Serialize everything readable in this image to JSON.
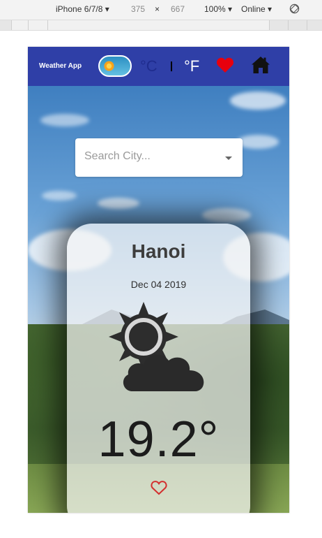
{
  "devtools": {
    "device": "iPhone 6/7/8 ▾",
    "width": "375",
    "times": "×",
    "height": "667",
    "zoom": "100% ▾",
    "network": "Online ▾",
    "rotate_icon": "rotate-icon"
  },
  "appbar": {
    "brand": "Weather App",
    "theme_toggle_icon": "sun-icon",
    "unit_celsius": "°C",
    "unit_fahrenheit": "°F",
    "favorites_icon": "heart-filled-icon",
    "home_icon": "home-icon",
    "colors": {
      "bar": "#2f3fa7",
      "active_unit": "#1f2c8e",
      "inactive_unit": "#ffffff",
      "heart": "#e8000d"
    }
  },
  "search": {
    "placeholder": "Search City...",
    "dropdown_icon": "caret-down-icon"
  },
  "card": {
    "city": "Hanoi",
    "date": "Dec 04 2019",
    "condition_icon": "partly-cloudy-icon",
    "temperature": "19.2°",
    "favorite_icon": "heart-outline-icon",
    "colors": {
      "favorite": "#d32f2f"
    }
  }
}
